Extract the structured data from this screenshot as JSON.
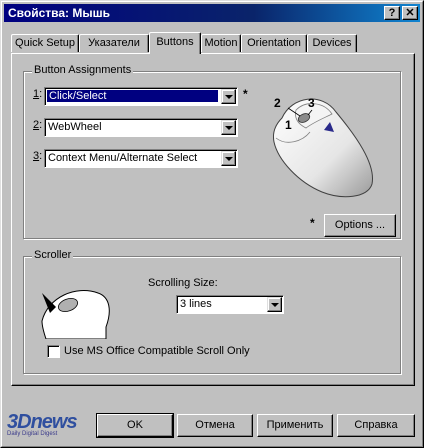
{
  "window": {
    "title": "Свойства: Мышь",
    "help_label": "?",
    "close_label": "✕"
  },
  "tabs": [
    {
      "label": "Quick Setup"
    },
    {
      "label": "Указатели"
    },
    {
      "label": "Buttons"
    },
    {
      "label": "Motion"
    },
    {
      "label": "Orientation"
    },
    {
      "label": "Devices"
    }
  ],
  "active_tab": "Buttons",
  "button_assignments": {
    "group_label": "Button Assignments",
    "rows": [
      {
        "number": "1",
        "suffix": ":",
        "value": "Click/Select"
      },
      {
        "number": "2",
        "suffix": ":",
        "value": "WebWheel"
      },
      {
        "number": "3",
        "suffix": ":",
        "value": "Context Menu/Alternate Select"
      }
    ],
    "asterisk": "*",
    "mouse_labels": [
      "2",
      "3",
      "1"
    ],
    "options_label": "Options ..."
  },
  "scroller": {
    "group_label": "Scroller",
    "size_label": "Scrolling Size:",
    "size_value": "3 lines",
    "checkbox_label": "Use MS Office Compatible Scroll Only",
    "checkbox_checked": false
  },
  "footer": {
    "logo_text": "3Dnews",
    "logo_subtext": "Daily Digital Digest",
    "ok_label": "OK",
    "cancel_label": "Отмена",
    "apply_label": "Применить",
    "help_label": "Справка"
  },
  "colors": {
    "face": "#c0c0c0",
    "title_active": "#000080",
    "selection": "#000080"
  }
}
